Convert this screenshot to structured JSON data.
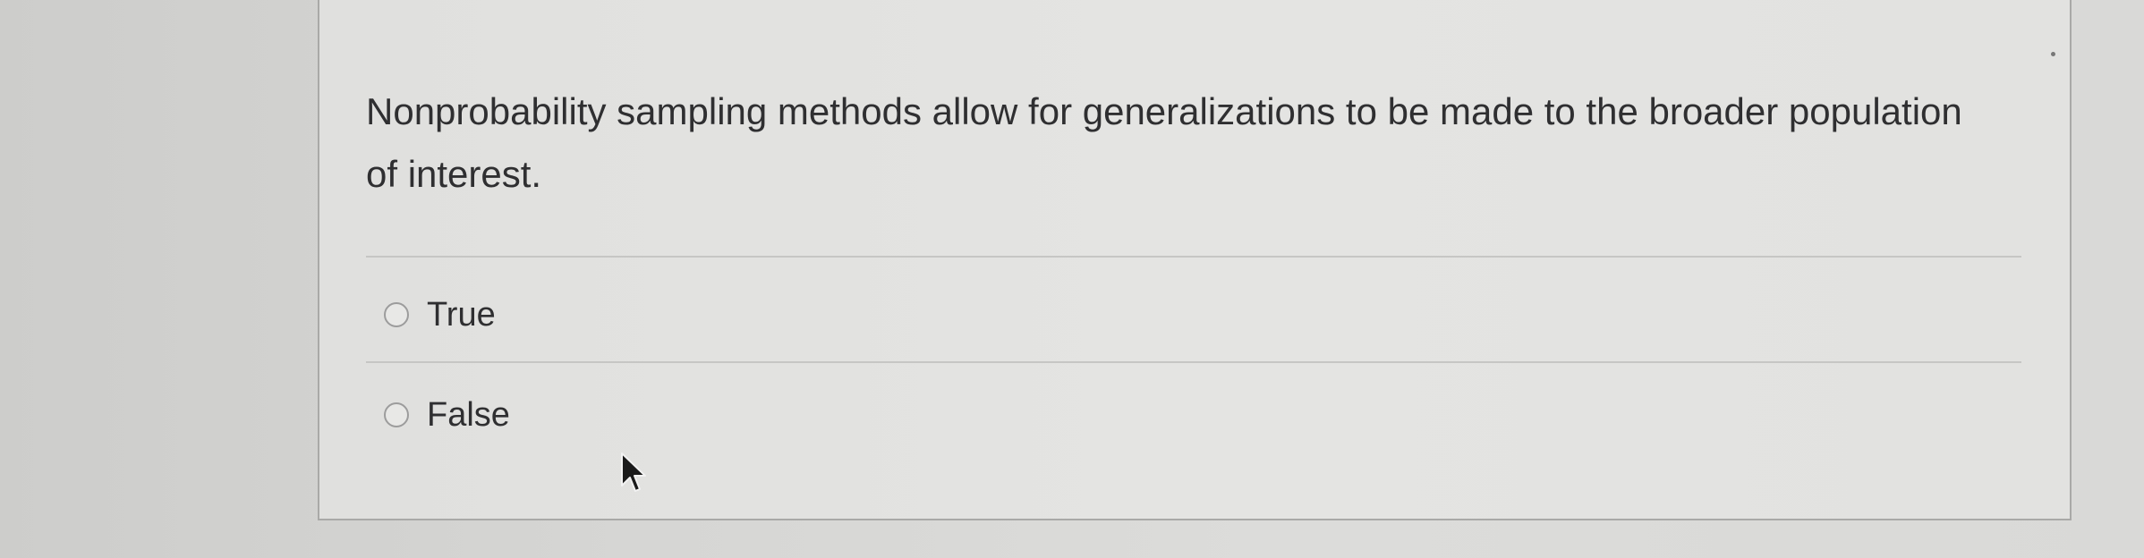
{
  "question": {
    "text": "Nonprobability sampling methods allow for generalizations to be made to the broader population of interest."
  },
  "options": [
    {
      "label": "True",
      "selected": false
    },
    {
      "label": "False",
      "selected": false
    }
  ],
  "colors": {
    "background": "#d3d3d1",
    "card": "#e2e2e0",
    "text": "#2f2f31",
    "border": "#a9a9a7"
  },
  "icons": {
    "cursor": "mouse-pointer-icon",
    "radio": "radio-button-icon"
  }
}
